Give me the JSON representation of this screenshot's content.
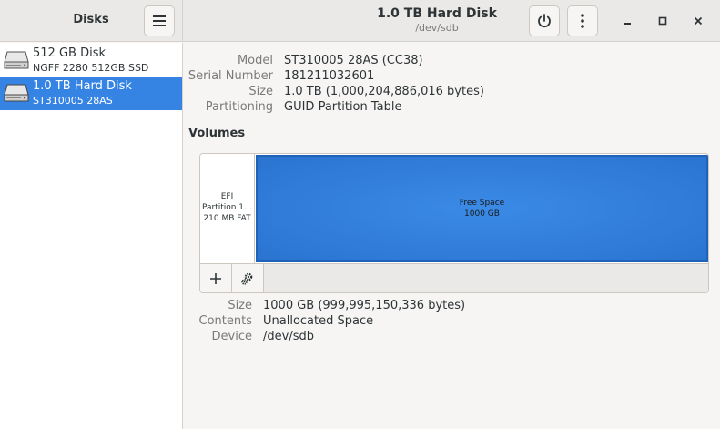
{
  "sidebar": {
    "title": "Disks",
    "disks": [
      {
        "name": "512 GB Disk",
        "sub": "NGFF 2280 512GB SSD"
      },
      {
        "name": "1.0 TB Hard Disk",
        "sub": "ST310005 28AS"
      }
    ],
    "selected_index": 1
  },
  "header": {
    "title": "1.0 TB Hard Disk",
    "subtitle": "/dev/sdb"
  },
  "drive": {
    "model_label": "Model",
    "model": "ST310005 28AS (CC38)",
    "serial_label": "Serial Number",
    "serial": "181211032601",
    "size_label": "Size",
    "size": "1.0 TB (1,000,204,886,016 bytes)",
    "partitioning_label": "Partitioning",
    "partitioning": "GUID Partition Table"
  },
  "volumes": {
    "heading": "Volumes",
    "partitions": [
      {
        "line1": "EFI",
        "line2": "Partition 1…",
        "line3": "210 MB FAT"
      },
      {
        "line1": "Free Space",
        "line2": "1000 GB"
      }
    ]
  },
  "selected_volume": {
    "size_label": "Size",
    "size": "1000 GB (999,995,150,336 bytes)",
    "contents_label": "Contents",
    "contents": "Unallocated Space",
    "device_label": "Device",
    "device": "/dev/sdb"
  },
  "colors": {
    "accent": "#3584e4",
    "free_space": "#2a74d0"
  }
}
